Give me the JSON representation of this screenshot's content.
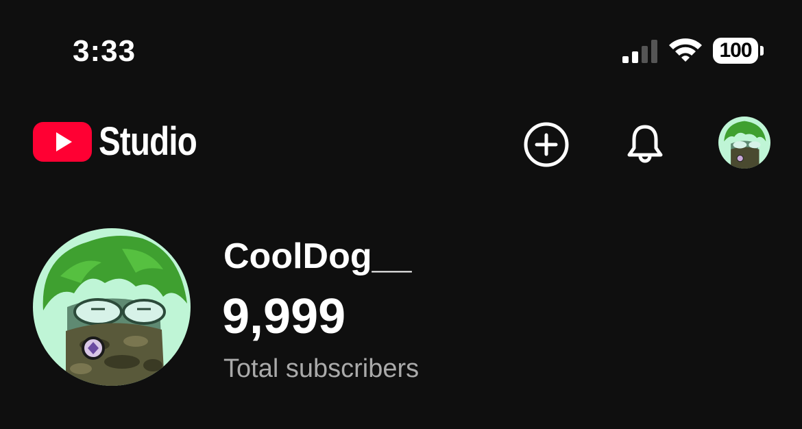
{
  "status_bar": {
    "time": "3:33",
    "battery": "100",
    "signal_icon": "cellular-signal-icon",
    "wifi_icon": "wifi-icon"
  },
  "header": {
    "logo_text": "Studio",
    "logo_icon": "youtube-play-icon",
    "brand_color": "#ff0033",
    "create_icon": "plus-circle-icon",
    "notifications_icon": "bell-icon",
    "account_icon": "avatar"
  },
  "channel": {
    "name": "CoolDog__",
    "subscriber_count": "9,999",
    "subscriber_label": "Total subscribers"
  }
}
